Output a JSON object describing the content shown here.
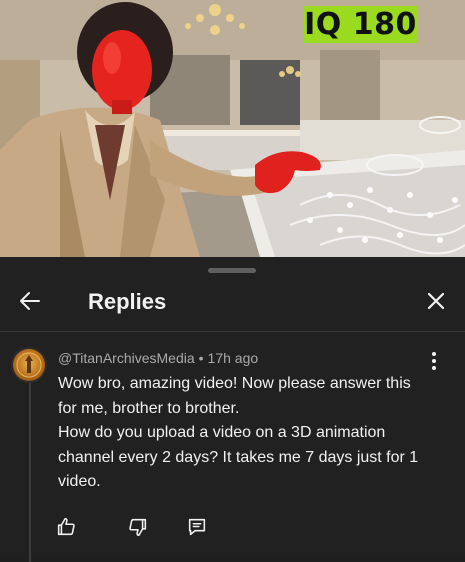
{
  "thumbnail": {
    "badge_text": "IQ 180",
    "badge_color": "#9bdb1f"
  },
  "sheet": {
    "title": "Replies",
    "back_icon": "arrow-left-icon",
    "close_icon": "close-icon"
  },
  "comment": {
    "author": "@TitanArchivesMedia",
    "separator": "•",
    "time": "17h ago",
    "lines": [
      "Wow bro, amazing video! Now please answer this",
      "for me, brother to brother.",
      "How do you upload a video on a 3D animation",
      "channel every 2 days? It takes me 7 days just for 1",
      "video."
    ],
    "actions": [
      "thumbs-up-icon",
      "thumbs-down-icon",
      "reply-icon"
    ]
  },
  "colors": {
    "background": "#212121",
    "text": "#f1f1f1",
    "secondary_text": "#aaaaaa"
  }
}
